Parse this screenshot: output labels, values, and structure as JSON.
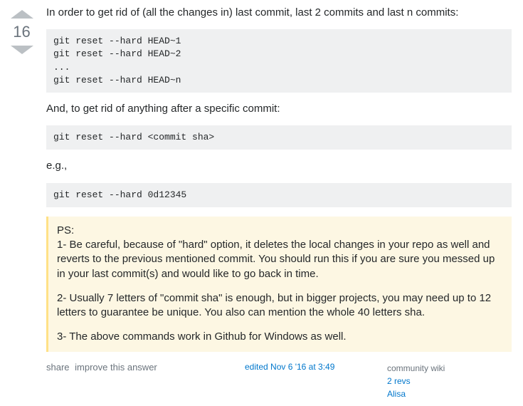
{
  "vote": {
    "count": "16"
  },
  "body": {
    "intro": "In order to get rid of (all the changes in) last commit, last 2 commits and last n commits:",
    "code1": "git reset --hard HEAD~1\ngit reset --hard HEAD~2\n...\ngit reset --hard HEAD~n",
    "p2": "And, to get rid of anything after a specific commit:",
    "code2": "git reset --hard <commit sha>",
    "p3": "e.g.,",
    "code3": "git reset --hard 0d12345",
    "note": {
      "ps": "PS:",
      "n1": "1- Be careful, because of \"hard\" option, it deletes the local changes in your repo as well and reverts to the previous mentioned commit. You should run this if you are sure you messed up in your last commit(s) and would like to go back in time.",
      "n2": "2- Usually 7 letters of \"commit sha\" is enough, but in bigger projects, you may need up to 12 letters to guarantee be unique. You also can mention the whole 40 letters sha.",
      "n3": "3- The above commands work in Github for Windows as well."
    }
  },
  "menu": {
    "share": "share",
    "improve": "improve this answer",
    "edited": "edited Nov 6 '16 at 3:49",
    "wiki": "community wiki",
    "revs": "2 revs",
    "author": "Alisa"
  }
}
